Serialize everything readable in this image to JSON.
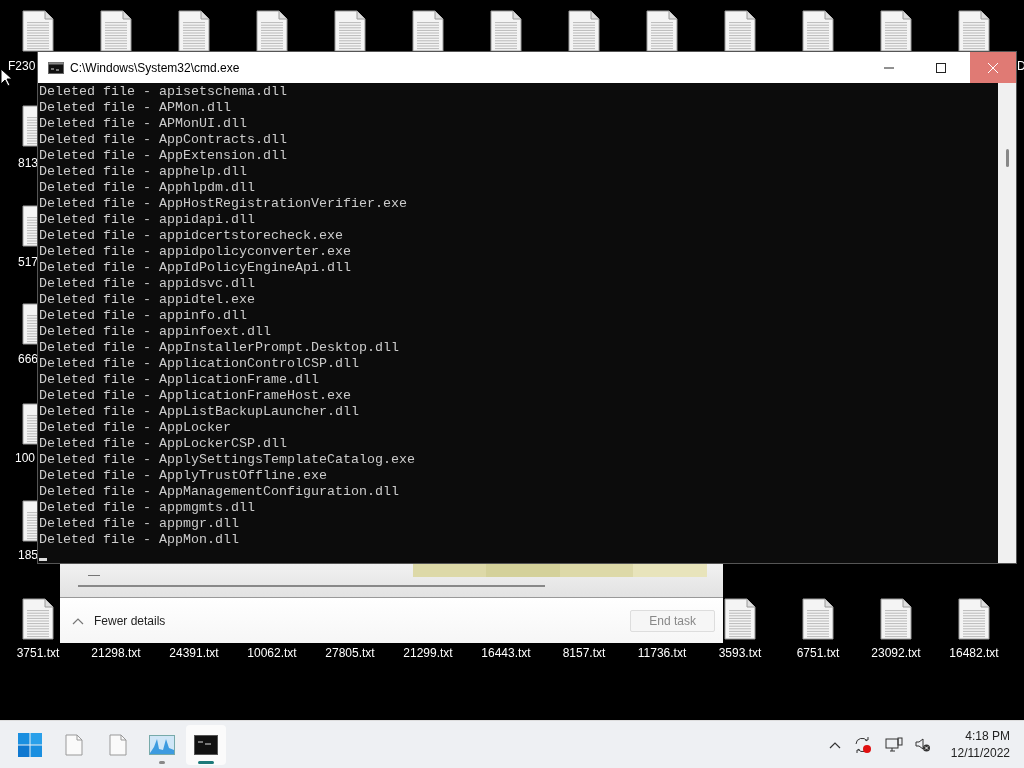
{
  "desktop": {
    "top_row_edge_labels": [
      "F230",
      "D"
    ],
    "left_column_labels": [
      "813",
      "517",
      "666",
      "100",
      "185"
    ],
    "bottom_row_labels": [
      "3751.txt",
      "21298.txt",
      "24391.txt",
      "10062.txt",
      "27805.txt",
      "21299.txt",
      "16443.txt",
      "8157.txt",
      "11736.txt",
      "3593.txt",
      "6751.txt",
      "23092.txt",
      "16482.txt"
    ]
  },
  "console_window": {
    "title": "C:\\Windows\\System32\\cmd.exe",
    "close_highlighted": true,
    "lines": [
      "Deleted file - apisetschema.dll",
      "Deleted file - APMon.dll",
      "Deleted file - APMonUI.dll",
      "Deleted file - AppContracts.dll",
      "Deleted file - AppExtension.dll",
      "Deleted file - apphelp.dll",
      "Deleted file - Apphlpdm.dll",
      "Deleted file - AppHostRegistrationVerifier.exe",
      "Deleted file - appidapi.dll",
      "Deleted file - appidcertstorecheck.exe",
      "Deleted file - appidpolicyconverter.exe",
      "Deleted file - AppIdPolicyEngineApi.dll",
      "Deleted file - appidsvc.dll",
      "Deleted file - appidtel.exe",
      "Deleted file - appinfo.dll",
      "Deleted file - appinfoext.dll",
      "Deleted file - AppInstallerPrompt.Desktop.dll",
      "Deleted file - ApplicationControlCSP.dll",
      "Deleted file - ApplicationFrame.dll",
      "Deleted file - ApplicationFrameHost.exe",
      "Deleted file - AppListBackupLauncher.dll",
      "Deleted file - AppLocker",
      "Deleted file - AppLockerCSP.dll",
      "Deleted file - ApplySettingsTemplateCatalog.exe",
      "Deleted file - ApplyTrustOffline.exe",
      "Deleted file - AppManagementConfiguration.dll",
      "Deleted file - appmgmts.dll",
      "Deleted file - appmgr.dll",
      "Deleted file - AppMon.dll"
    ]
  },
  "task_manager": {
    "cell_text": "—",
    "details_toggle": "Fewer details",
    "end_task": {
      "label": "End task",
      "disabled": true
    }
  },
  "taskbar": {
    "apps": [
      {
        "kind": "start",
        "running": false,
        "selected": false
      },
      {
        "kind": "file",
        "running": false,
        "selected": false
      },
      {
        "kind": "file",
        "running": false,
        "selected": false
      },
      {
        "kind": "monitor",
        "running": true,
        "selected": false
      },
      {
        "kind": "console",
        "running": true,
        "selected": true
      }
    ],
    "time": "4:18 PM",
    "date": "12/11/2022"
  }
}
